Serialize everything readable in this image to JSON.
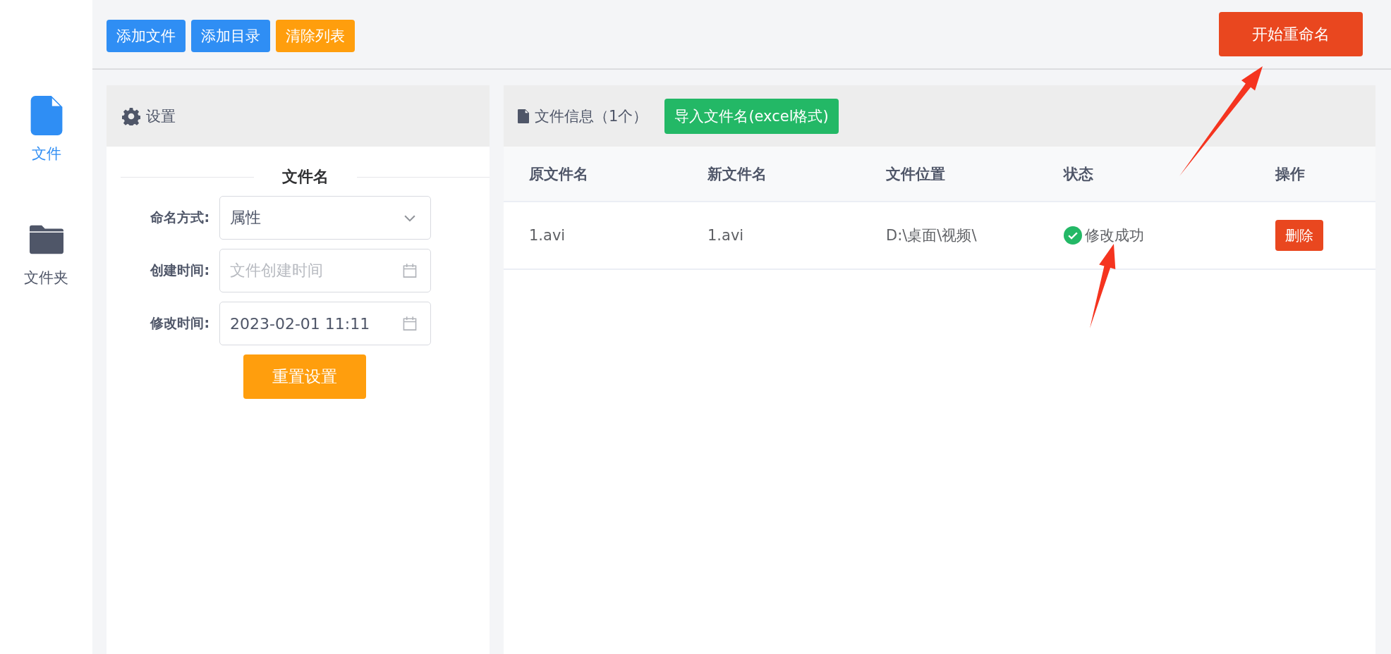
{
  "sidebar": {
    "items": [
      {
        "label": "文件",
        "kind": "file",
        "selected": true
      },
      {
        "label": "文件夹",
        "kind": "folder",
        "selected": false
      }
    ]
  },
  "toolbar": {
    "buttons": [
      {
        "label": "添加文件",
        "kind": "primary"
      },
      {
        "label": "添加目录",
        "kind": "primary"
      },
      {
        "label": "清除列表",
        "kind": "warning"
      }
    ],
    "start_button": "开始重命名"
  },
  "settings": {
    "title": "设置",
    "section": "文件名",
    "fields": [
      {
        "label": "命名方式:",
        "kind": "select",
        "value": "属性"
      },
      {
        "label": "创建时间:",
        "kind": "date",
        "placeholder": "文件创建时间"
      },
      {
        "label": "修改时间:",
        "kind": "date",
        "value": "2023-02-01 11:11"
      }
    ],
    "reset_button": "重置设置"
  },
  "files": {
    "title": "文件信息（1个）",
    "import_button": "导入文件名(excel格式)",
    "columns": [
      "原文件名",
      "新文件名",
      "文件位置",
      "状态",
      "操作"
    ],
    "rows": [
      {
        "original": "1.avi",
        "new": "1.avi",
        "location": "D:\\桌面\\视频\\",
        "status": "修改成功",
        "success": true,
        "action": "删除"
      }
    ]
  },
  "annotations": [
    {
      "kind": "arrow"
    },
    {
      "kind": "arrow"
    }
  ]
}
